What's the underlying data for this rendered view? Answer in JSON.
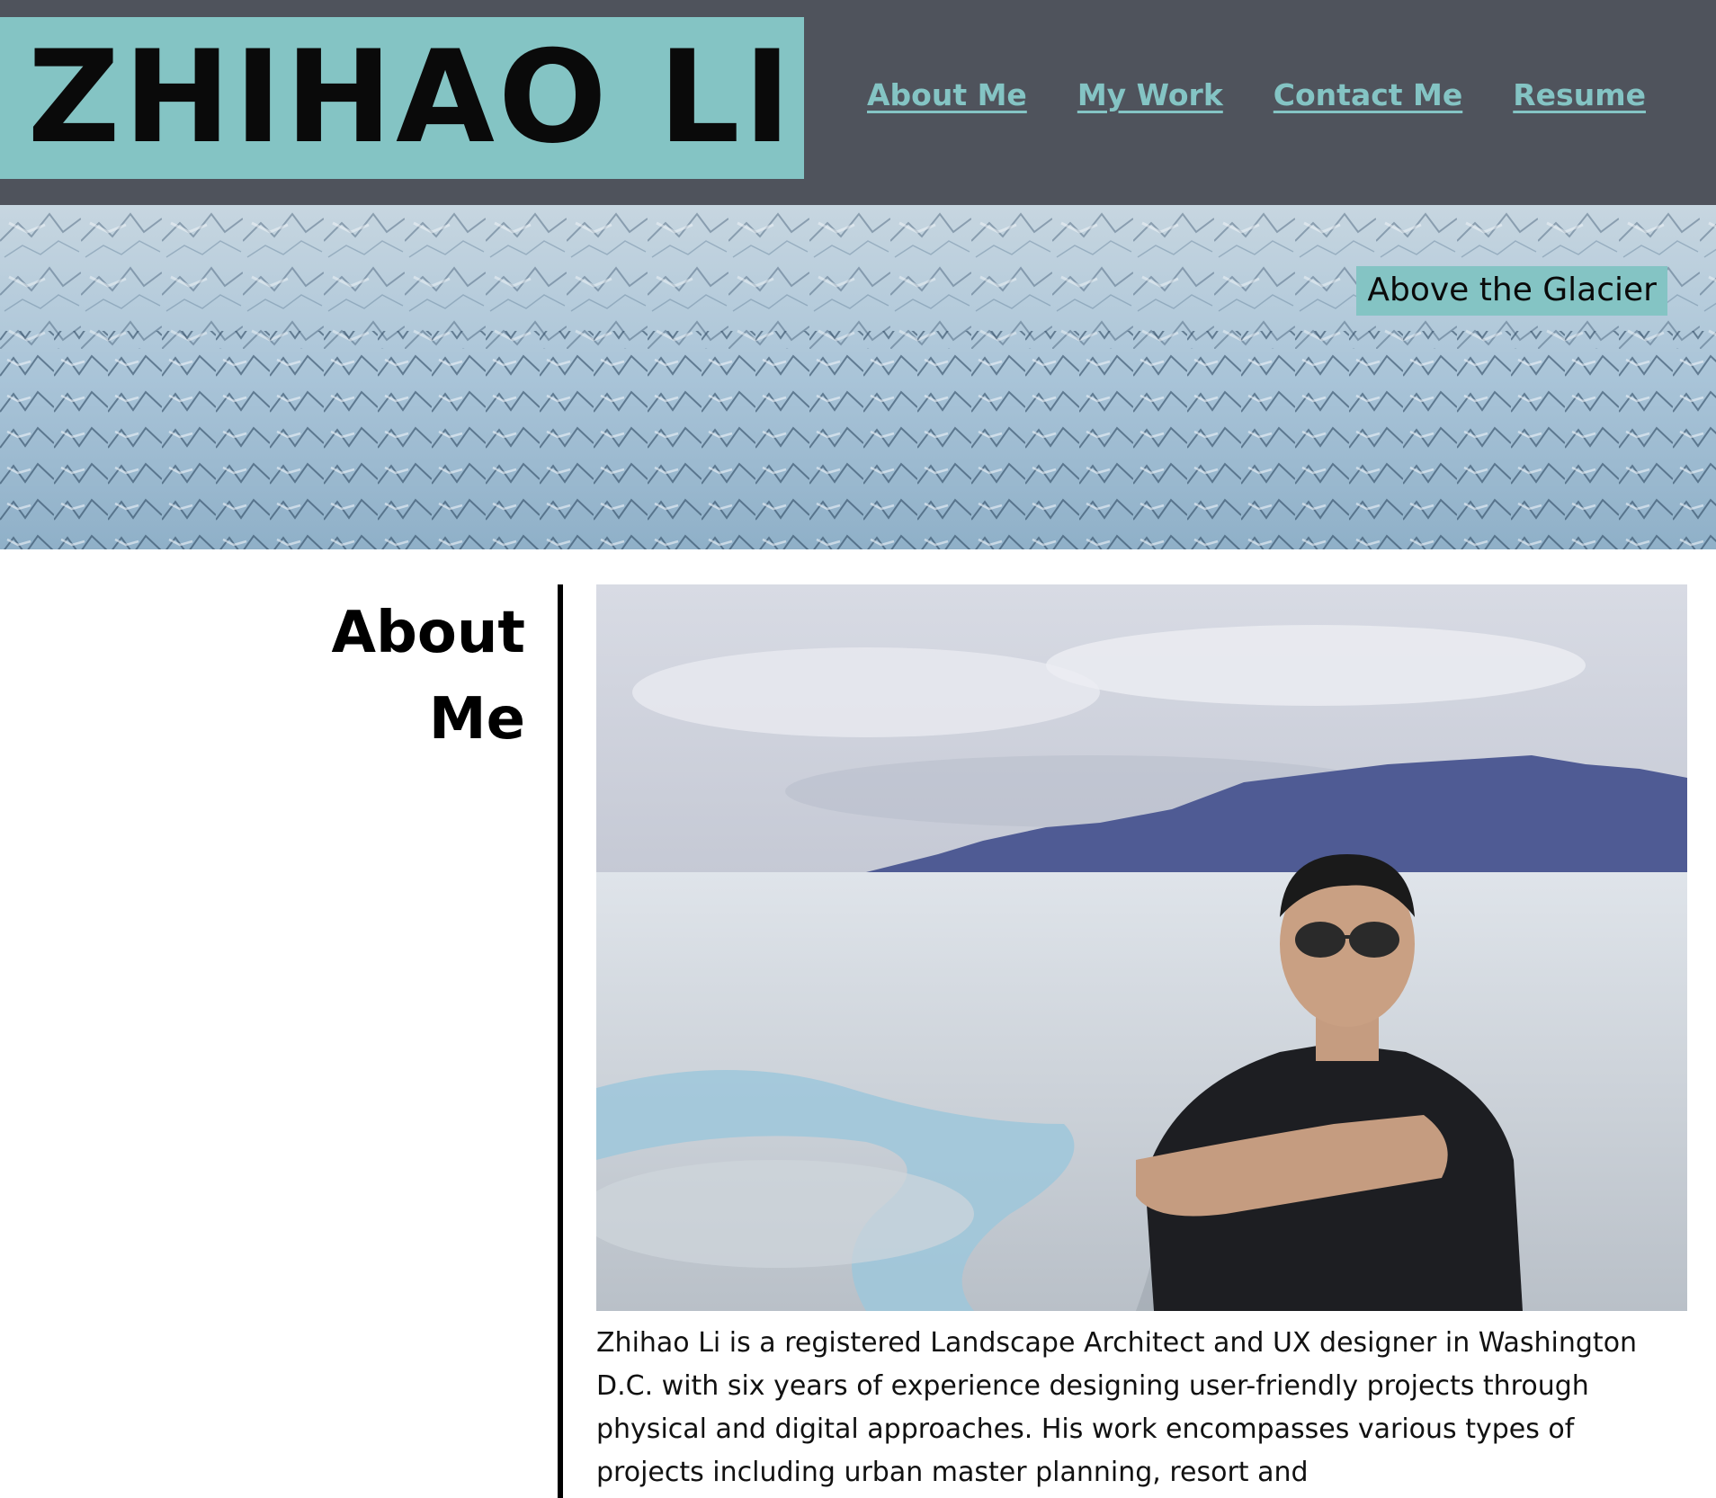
{
  "header": {
    "site_title": "ZHIHAO LI",
    "nav": [
      {
        "label": "About Me"
      },
      {
        "label": "My Work"
      },
      {
        "label": "Contact Me"
      },
      {
        "label": "Resume"
      }
    ]
  },
  "hero": {
    "caption": "Above the Glacier"
  },
  "about": {
    "title_line1": "About",
    "title_line2": "Me",
    "bio": "Zhihao Li is a registered Landscape Architect and UX designer in Washington D.C. with six years of experience designing user-friendly projects through physical and digital approaches. His work encompasses various types of projects including urban master planning, resort and"
  },
  "colors": {
    "header_bg": "#4f535c",
    "accent": "#84c4c4",
    "text": "#0a0a0a"
  }
}
